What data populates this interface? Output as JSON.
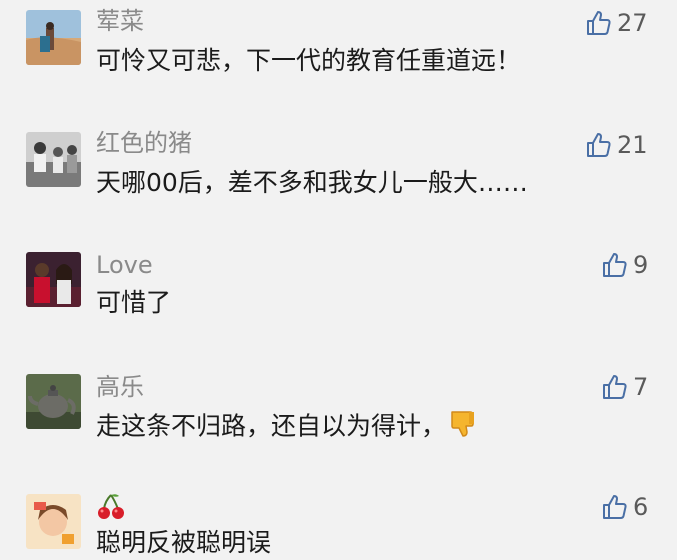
{
  "comments": [
    {
      "name": "荤菜",
      "text": "可怜又可悲，下一代的教育任重道远！",
      "likes": "27",
      "avatar_icon": "desert-person-avatar"
    },
    {
      "name": "红色的猪",
      "text": "天哪00后，差不多和我女儿一般大……",
      "likes": "21",
      "avatar_icon": "bw-group-photo-avatar"
    },
    {
      "name": "Love",
      "text": "可惜了",
      "likes": "9",
      "avatar_icon": "basketball-couple-avatar"
    },
    {
      "name": "高乐",
      "text": "走这条不归路，还自以为得计，",
      "likes": "7",
      "avatar_icon": "teapot-avatar",
      "text_emoji": "thumbs-down-icon"
    },
    {
      "name_emoji": "cherries-icon",
      "name": "",
      "text": "聪明反被聪明误",
      "likes": "6",
      "avatar_icon": "cartoon-girl-avatar"
    }
  ],
  "colors": {
    "background": "#f2f2f2",
    "name": "#8a8a8a",
    "text": "#1b1b1b",
    "like_icon": "#4a6fa5"
  }
}
